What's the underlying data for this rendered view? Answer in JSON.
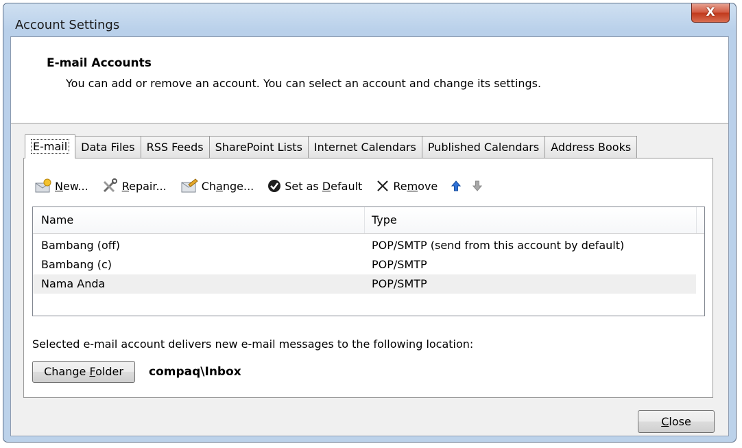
{
  "window": {
    "title": "Account Settings",
    "close_glyph": "X"
  },
  "header": {
    "title": "E-mail Accounts",
    "description": "You can add or remove an account. You can select an account and change its settings."
  },
  "tabs": [
    {
      "label": "E-mail",
      "active": true
    },
    {
      "label": "Data Files"
    },
    {
      "label": "RSS Feeds"
    },
    {
      "label": "SharePoint Lists"
    },
    {
      "label": "Internet Calendars"
    },
    {
      "label": "Published Calendars"
    },
    {
      "label": "Address Books"
    }
  ],
  "toolbar": {
    "new": {
      "pre": "",
      "key": "N",
      "post": "ew...",
      "icon": "new-account-icon"
    },
    "repair": {
      "pre": "",
      "key": "R",
      "post": "epair...",
      "icon": "repair-tools-icon"
    },
    "change": {
      "pre": "Ch",
      "key": "a",
      "post": "nge...",
      "icon": "change-icon"
    },
    "set_default": {
      "pre": "Set as ",
      "key": "D",
      "post": "efault",
      "icon": "checkmark-icon"
    },
    "remove": {
      "pre": "Re",
      "key": "m",
      "post": "ove",
      "icon": "remove-x-icon"
    },
    "move_up_icon": "arrow-up-icon",
    "move_down_icon": "arrow-down-icon"
  },
  "accounts": {
    "columns": {
      "name": "Name",
      "type": "Type"
    },
    "rows": [
      {
        "name": "Bambang (off)",
        "type": "POP/SMTP (send from this account by default)"
      },
      {
        "name": "Bambang (c)",
        "type": "POP/SMTP"
      },
      {
        "name": "Nama Anda",
        "type": "POP/SMTP",
        "selected": true
      }
    ]
  },
  "location": {
    "text": "Selected e-mail account delivers new e-mail messages to the following location:",
    "change_folder": {
      "pre": "Change ",
      "key": "F",
      "post": "older"
    },
    "path": "compaq\\Inbox"
  },
  "footer": {
    "close": {
      "pre": "",
      "key": "C",
      "post": "lose"
    }
  },
  "colors": {
    "accent_blue": "#2f72d8",
    "disabled_gray": "#a8a8a8",
    "close_red": "#c73b1e"
  }
}
